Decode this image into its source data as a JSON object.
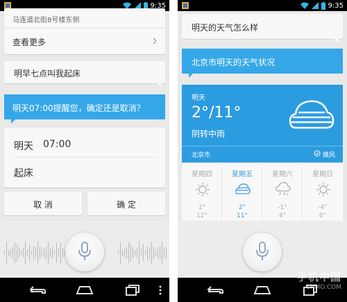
{
  "status": {
    "time_left": "9:35",
    "time_right": "9:35"
  },
  "left": {
    "address": "马连道北街8号楼东侧",
    "see_more": "查看更多",
    "query": "明早七点叫我起床",
    "prompt": "明天07:00提醒您，确定还是取消？",
    "alarm_day": "明天",
    "alarm_time": "07:00",
    "alarm_label": "起床",
    "cancel": "取 消",
    "confirm": "确 定"
  },
  "right": {
    "query": "明天的天气怎么样",
    "heading": "北京市明天的天气状况",
    "day": "明天",
    "temp": "2°/11°",
    "condition": "阴转中雨",
    "city": "北京市",
    "wind": "微风",
    "forecast": [
      {
        "day": "星期四",
        "hi": "1°",
        "lo": "12°"
      },
      {
        "day": "星期五",
        "hi": "2°",
        "lo": "11°"
      },
      {
        "day": "星期六",
        "hi": "-1°",
        "lo": "4°"
      },
      {
        "day": "星期日",
        "hi": "-4°",
        "lo": "6°"
      }
    ]
  },
  "watermark": {
    "main": "手机中国",
    "sub": "CNMO.COM"
  },
  "icons": [
    "wifi-icon",
    "signal-icon",
    "battery-icon",
    "notification-icon",
    "chevron-right-icon",
    "mic-icon",
    "back-icon",
    "home-icon",
    "recents-icon",
    "menu-icon",
    "cloud-icon",
    "sun-icon",
    "snow-rain-icon",
    "check-circle-icon"
  ],
  "colors": {
    "accent": "#35a7e8",
    "weather": "#2b9ce0",
    "background": "#e9e9e9"
  }
}
